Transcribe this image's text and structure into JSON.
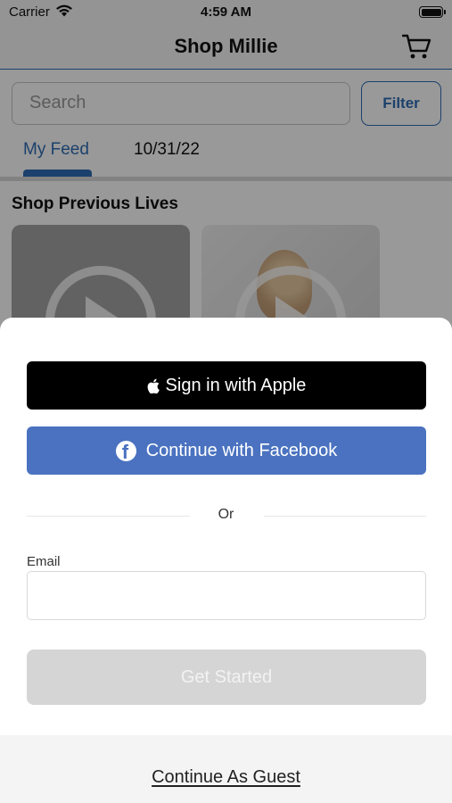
{
  "status_bar": {
    "carrier": "Carrier",
    "time": "4:59 AM",
    "wifi_icon": "wifi-icon",
    "battery_icon": "battery-icon"
  },
  "header": {
    "title": "Shop Millie",
    "cart_icon": "cart-icon"
  },
  "search": {
    "placeholder": "Search",
    "filter_label": "Filter"
  },
  "tabs": [
    {
      "label": "My Feed",
      "active": true
    },
    {
      "label": "10/31/22",
      "active": false
    }
  ],
  "section": {
    "title": "Shop Previous Lives",
    "cards": [
      {
        "play_icon": "play-icon"
      },
      {
        "play_icon": "play-icon"
      }
    ]
  },
  "sheet": {
    "apple_button": "Sign in with Apple",
    "facebook_button": "Continue with Facebook",
    "divider_text": "Or",
    "email_label": "Email",
    "email_value": "",
    "submit_button": "Get Started",
    "guest_link": "Continue As Guest"
  },
  "colors": {
    "accent": "#2f6db5",
    "facebook": "#4a72c0",
    "apple": "#000000",
    "disabled_button": "#d5d5d5"
  }
}
